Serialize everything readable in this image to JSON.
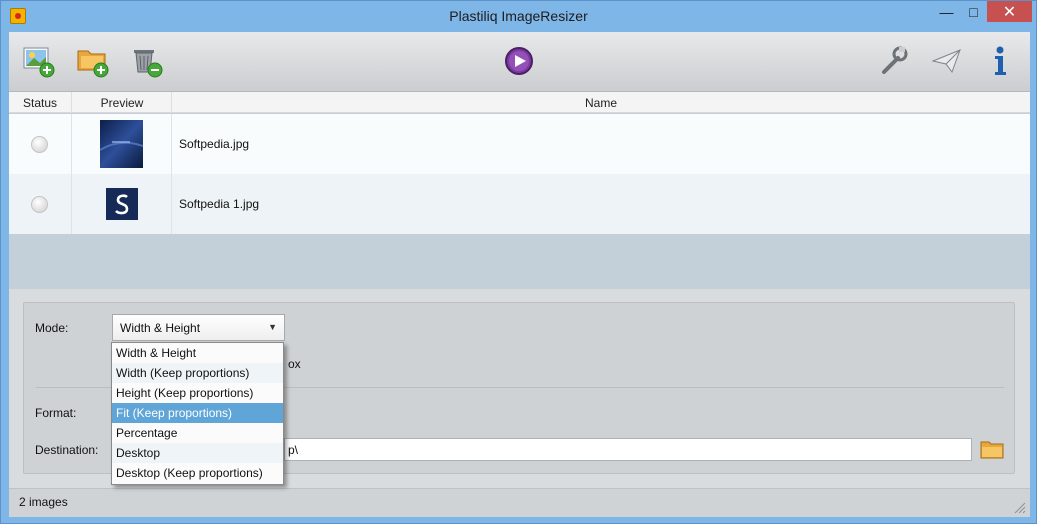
{
  "window": {
    "title": "Plastiliq ImageResizer"
  },
  "window_controls": {
    "minimize": "—",
    "maximize": "□",
    "close": "✕"
  },
  "toolbar": {
    "buttons": [
      {
        "name": "add-images",
        "icon": "add-image-icon"
      },
      {
        "name": "add-folder",
        "icon": "add-folder-icon"
      },
      {
        "name": "remove",
        "icon": "trash-remove-icon"
      },
      {
        "name": "start",
        "icon": "play-icon"
      },
      {
        "name": "settings",
        "icon": "wrench-icon"
      },
      {
        "name": "send",
        "icon": "paper-plane-icon"
      },
      {
        "name": "about",
        "icon": "info-icon"
      }
    ],
    "accent": "#7a3a9e"
  },
  "grid": {
    "columns": [
      "Status",
      "Preview",
      "Name"
    ],
    "rows": [
      {
        "name": "Softpedia.jpg",
        "preview": "blue-image-thumbnail"
      },
      {
        "name": "Softpedia 1.jpg",
        "preview": "softpedia-s-logo-thumbnail"
      }
    ]
  },
  "settings": {
    "mode_label": "Mode:",
    "mode_value": "Width & Height",
    "hidden_checkbox_suffix": "ox",
    "format_label": "Format:",
    "destination_label": "Destination:",
    "destination_value_suffix": "p\\"
  },
  "dropdown": {
    "options": [
      "Width & Height",
      "Width (Keep proportions)",
      "Height (Keep proportions)",
      "Fit (Keep proportions)",
      "Percentage",
      "Desktop",
      "Desktop (Keep proportions)"
    ],
    "selected_index": 3,
    "selected_color": "#5fa5d7"
  },
  "statusbar": {
    "text": "2 images"
  }
}
